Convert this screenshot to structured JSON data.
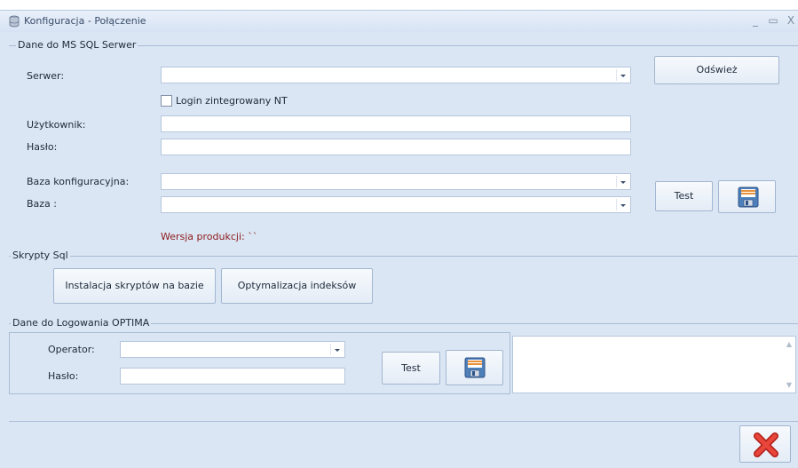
{
  "window": {
    "title": "Konfiguracja - Połączenie",
    "minimize": "_",
    "maximize": "▭",
    "close": "X"
  },
  "sql_group": {
    "title": "Dane do MS SQL Serwer",
    "server_label": "Serwer:",
    "server_value": "",
    "refresh_button": "Odśwież",
    "nt_login_label": "Login zintegrowany NT",
    "nt_login_checked": false,
    "user_label": "Użytkownik:",
    "user_value": "",
    "password_label": "Hasło:",
    "password_value": "",
    "config_db_label": "Baza konfiguracyjna:",
    "config_db_value": "",
    "db_label": "Baza :",
    "db_value": "",
    "test_button": "Test",
    "version_text": "Wersja produkcji: ``"
  },
  "scripts_group": {
    "title": "Skrypty Sql",
    "install_button": "Instalacja skryptów na bazie",
    "optimize_button": "Optymalizacja indeksów"
  },
  "optima_group": {
    "title": "Dane do Logowania OPTIMA",
    "operator_label": "Operator:",
    "operator_value": "",
    "password_label": "Hasło:",
    "password_value": "",
    "test_button": "Test",
    "log_text": ""
  },
  "colors": {
    "background": "#dbe6f4",
    "version_text": "#8b1a1a",
    "close_icon": "#d8322a"
  },
  "icons": [
    "database-icon",
    "save-icon",
    "close-x-icon"
  ]
}
